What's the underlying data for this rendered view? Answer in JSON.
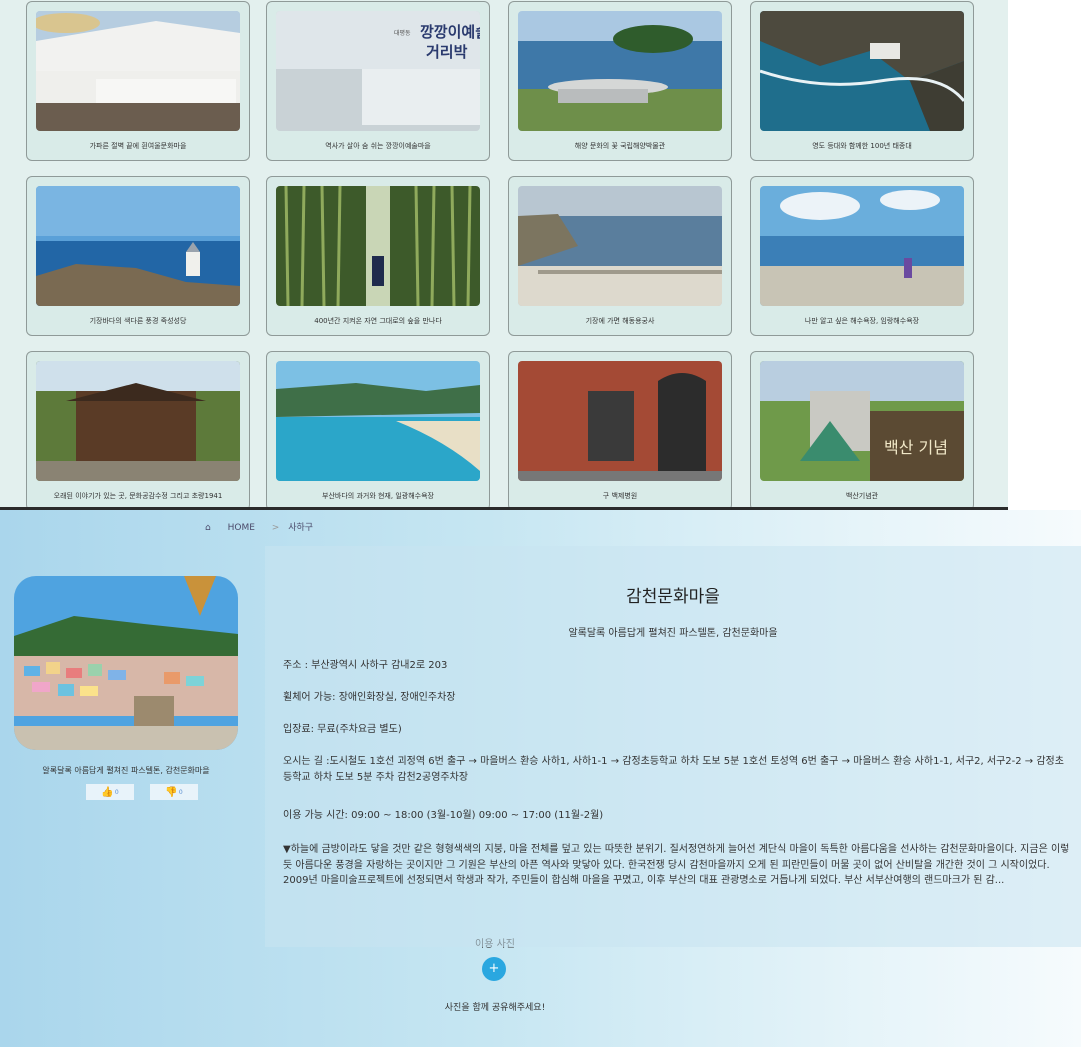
{
  "grid": {
    "cards": [
      {
        "caption": "가파른 절벽 끝에 흰여울문화마을",
        "icon": "coastal-village-image"
      },
      {
        "caption": "역사가 살아 숨 쉬는 깡깡이예술마을",
        "icon": "art-village-sign-image"
      },
      {
        "caption": "해양 문화의 꽃 국립해양박물관",
        "icon": "maritime-museum-image"
      },
      {
        "caption": "영도 등대와 함께한 100년 태종대",
        "icon": "taejongdae-lighthouse-image"
      },
      {
        "caption": "기장바다의 색다른 풍경 죽성성당",
        "icon": "seaside-church-image"
      },
      {
        "caption": "400년간 지켜온 자연 그대로의 숲을 만나다",
        "icon": "bamboo-forest-image"
      },
      {
        "caption": "기장에 가면 해동용궁사",
        "icon": "seaside-temple-image"
      },
      {
        "caption": "나만 알고 싶은 해수욕장, 임랑해수욕장",
        "icon": "beach-image"
      },
      {
        "caption": "오래된 이야기가 있는 곳, 문화공감수정 그리고 초량1941",
        "icon": "old-house-image"
      },
      {
        "caption": "부산바다의 과거와 현재, 일광해수욕장",
        "icon": "bay-image"
      },
      {
        "caption": "구 백제병원",
        "icon": "brick-building-image"
      },
      {
        "caption": "백산기념관",
        "icon": "memorial-hall-image"
      }
    ],
    "sign_text": {
      "line1": "깡깡이예술",
      "line2": "거리박",
      "small": "대평동"
    },
    "memorial_sign": "백산 기념"
  },
  "breadcrumb": {
    "home_icon": "home-icon",
    "home": "HOME",
    "separator": ">",
    "current": "사하구"
  },
  "detail": {
    "title": "감천문화마을",
    "subtitle": "알록달록 아름답게 펼쳐진 파스텔톤, 감천문화마을",
    "photo_caption": "알록달록 아름답게 펼쳐진 파스텔톤, 감천문화마을",
    "like_count": "0",
    "dislike_count": "0",
    "address": "주소 : 부산광역시 사하구 감내2로 203",
    "wheelchair": "휠체어 가능: 장애인화장실, 장애인주차장",
    "fee": "입장료: 무료(주차요금 별도)",
    "directions": "오시는 길 :도시철도 1호선 괴정역 6번 출구 → 마을버스 환승 사하1, 사하1-1 → 감정초등학교 하차 도보 5분 1호선 토성역 6번 출구 → 마을버스 환승 사하1-1, 서구2, 서구2-2 → 감정초등학교 하차 도보 5분 주차 감천2공영주차장",
    "hours": "이용 가능 시간: 09:00 ~ 18:00 (3월-10월) 09:00 ~ 17:00 (11월-2월)",
    "description": "▼하늘에 금방이라도 닿을 것만 같은 형형색색의 지붕, 마을 전체를 덮고 있는 따뜻한 분위기. 질서정연하게 늘어선 계단식 마을이 독특한 아름다움을 선사하는 감천문화마을이다. 지금은 이렇듯 아름다운 풍경을 자랑하는 곳이지만 그 기원은 부산의 아픈 역사와 맞닿아 있다. 한국전쟁 당시 감천마을까지 오게 된 피란민들이 머물 곳이 없어 산비탈을 개간한 것이 그 시작이었다. 2009년 마을미술프로젝트에 선정되면서 학생과 작가, 주민들이 합심해 마을을 꾸몄고, 이후 부산의 대표 관광명소로 거듭나게 되었다. 부산 서부산여행의 랜드마크가 된 감..."
  },
  "photos": {
    "title": "이용 사진",
    "add_label": "+",
    "share_text": "사진을 함께 공유해주세요!"
  },
  "colors": {
    "accent": "#2aa7e0",
    "grid_bg": "#e3f0ee",
    "card_bg": "#d9ebe8"
  }
}
